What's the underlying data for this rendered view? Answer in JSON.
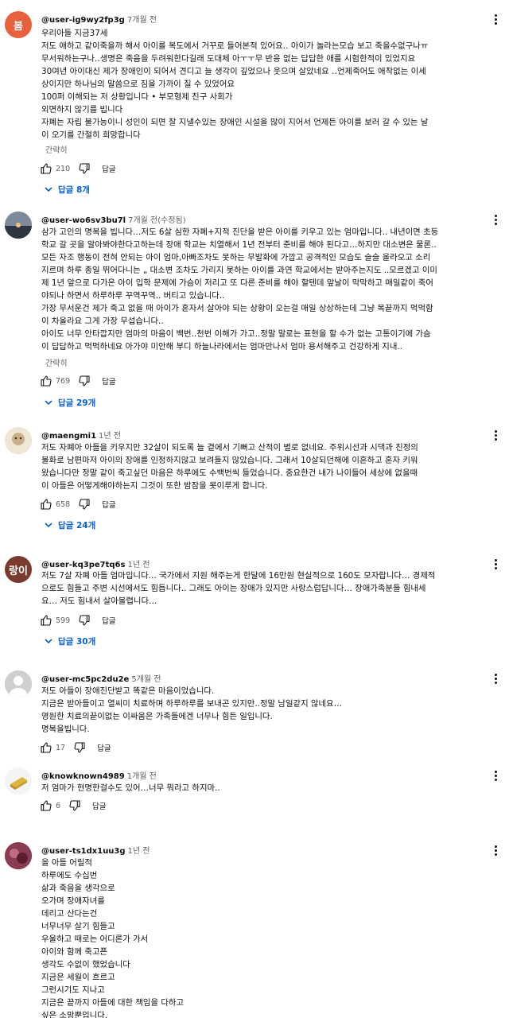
{
  "comments": [
    {
      "username": "@user-ig9wy2fp3g",
      "time": "7개월 전",
      "avatar_text": "봄",
      "avatar_color": "#e8603e",
      "lines": [
        "우리아들 지금37세",
        "저도 애하고 같이죽을까 해서 아이를 복도에서 거꾸로 들어본적 있어요‥ 아이가 놀라는모습 보고 죽을수없구나ㅠ",
        "무서워하는구나‥생명은 죽음을 두려워한다길래 도대체 아ㅜㅜ무 반응 없는 답답한 애를 시험한적이 있었지요",
        "30여년 아이대신 제가 장애인이 되어서 견디고 늘 생각이 깊었으나 웃으며 살았네요 ‥언제죽어도 애착없는 이세",
        "상이지만 하나님의 말씀으로 짐을 가까이 질 수 있었어요",
        "100퍼 이해되는 저 상황입니다 • 부모형제 친구 사회가",
        "외면하지 않기를 빕니다",
        "자폐는 자립 불가능이니 성인이 되면 잘 지낼수있는 장애인 시설을 많이 지어서 언제든 아이를 보러 갈 수 있는 날",
        "이 오기를 간절히 희망합니다"
      ],
      "show_less": "간략히",
      "likes": "210",
      "reply_label": "답글",
      "replies": "답글 8개"
    },
    {
      "username": "@user-wo6sv3bu7l",
      "time": "7개월 전(수정됨)",
      "avatar_text": "",
      "avatar_color": "#5b6a7a",
      "lines": [
        "삼가 고인의 명복을 빕니다…저도 6살 심한 자폐+지적 진단을 받은 아이를 키우고 있는 엄마입니다.. 내년이면 초등",
        "학교 갈 곳을 알아봐야한다고하는데 장애 학교는 치열해서 1년 전부터 준비를 해야 된다고…하지만 대소변은 물론..",
        "모든 자조 행동이 전혀 안되는 아이 엄마,아빠조차도 못하는 무발화에 가깝고 공격적인 모습도 슬슬 올라오고 소리",
        "지르며 하루 종일 뛰어다니는 „ 대소변 조차도 가리지 못하는 아이를 과연 학교에서는 받아주는지도 ..모르겠고 이미",
        "제 1년 앞으로 다가온 아이 입학 문제에 가슴이 저리고 또 다른 준비를 해야 할텐데 앞날이 막막하고 매일같이 죽어",
        "야되나 하면서 하루하루 꾸역꾸역.. 버티고 있습니다..",
        "가장 무서운건 제가 죽고 없을 때 아이가 혼자서 살아야 되는 상황이 오는걸 매일 상상하는데 그냥 목끝까지 먹먹함",
        "이 차올라요 그게 가장 무섭습니다..",
        "아이도 너무 안타깝지만 엄마의 마음이 백번..천번 이해가 가고..정말 말로는 표현을 할 수가 없는 고통이기에 가슴",
        "이 답답하고 먹먹하네요 아가야 미안해 부디 하늘나라에서는 엄마만나서 엄마 용서해주고 건강하게 지내.."
      ],
      "show_less": "간략히",
      "likes": "769",
      "reply_label": "답글",
      "replies": "답글 29개"
    },
    {
      "username": "@maengmi1",
      "time": "1년 전",
      "avatar_text": "",
      "avatar_color": "#d9c7a6",
      "lines": [
        "저도 자폐아 아들을 키우지만 32살이 되도록 늘 곁에서 기뻐고 산적이 별로 없네요. 주위시선과 시댁과 친정의",
        "불화로 남편마저 아이의 장애를 인정하지않고 보려들지 않았습니다. 그래서 10살되던해에 이혼하고 혼자 키워",
        "왔습니다만 정말 같이 죽고싶던 마음은 하루에도 수백번씩 들었습니다. 중요한건 내가 나이들어 세상에 없을때",
        "이 아들은 어떻게해야하는지 그것이 또한 밤잠을 못이루게 합니다."
      ],
      "show_less": "",
      "likes": "658",
      "reply_label": "답글",
      "replies": "답글 24개"
    },
    {
      "username": "@user-kq3pe7tq6s",
      "time": "1년 전",
      "avatar_text": "랑이",
      "avatar_color": "#7a3b2e",
      "lines": [
        "저도 7살 자폐 아들 엄마입니다… 국가에서 지원 해주는게 한달에 16만원 현실적으로 160도 모자랍니다… 경제적",
        "으로도 힘들고 주변 시선에서도 힘듭니다.. 그래도 아이는 장애가 있지만 사랑스럽답니다… 장애가족분들 힘내세",
        "요… 저도 힘내서 살아볼렵니다…"
      ],
      "show_less": "",
      "likes": "599",
      "reply_label": "답글",
      "replies": "답글 30개"
    },
    {
      "username": "@user-mc5pc2du2e",
      "time": "5개월 전",
      "avatar_text": "",
      "avatar_color": "#d0d0d0",
      "lines": [
        "저도 아들이 장애진단받고 똑같은 마음이었습니다.",
        "지금은 받아들이고 열씨미 치료하며 하루하루를 보내곤 있지만..정말 남일같지 않네요…",
        "영원한 치료의끝이없는 이싸움은 가족들에겐 너무나 힘든 일입니다.",
        "명복을빕니다."
      ],
      "show_less": "",
      "likes": "17",
      "reply_label": "답글",
      "replies": ""
    },
    {
      "username": "@knowknown4989",
      "time": "1개월 전",
      "avatar_text": "",
      "avatar_color": "#eeeeee",
      "lines": [
        "저 엄마가 현명한걸수도 있어…너무 뭐라고 하지마.."
      ],
      "show_less": "",
      "likes": "6",
      "reply_label": "답글",
      "replies": ""
    },
    {
      "username": "@user-ts1dx1uu3g",
      "time": "1년 전",
      "avatar_text": "",
      "avatar_color": "#6b2a3a",
      "lines": [
        "올 아들 어릴적",
        "하루에도 수십번",
        "삶과 죽음을 생각으로",
        "오가며 장애자녀를",
        "데리고 산다는건",
        "너무너무 살기 힘들고",
        "우울하고 때로는 어디론가 가서",
        "아이와 함께 죽고픈",
        "생각도 수없이 했었습니다",
        "지금은 세월이 흐르고",
        "그런시기도 지나고",
        "지금은 끝까지 아들에 대한 책임을 다하고",
        "싶은 소망뿐입니다."
      ],
      "show_less": "",
      "likes": "",
      "reply_label": "",
      "replies": ""
    }
  ]
}
